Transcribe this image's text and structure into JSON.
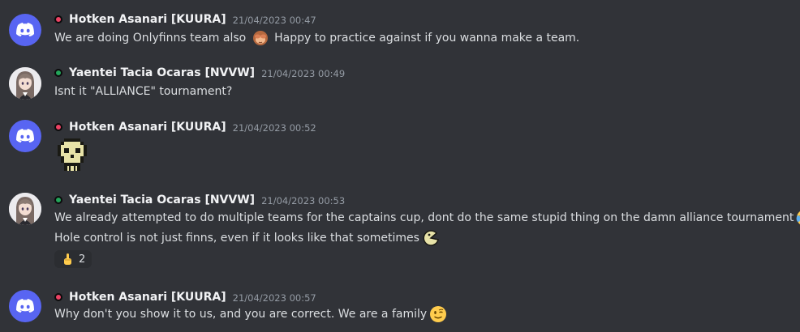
{
  "messages": [
    {
      "username": "Hotken Asanari [KUURA]",
      "timestamp": "21/04/2023 00:47",
      "role_color": "#ed4264",
      "avatar": "discord-logo-icon",
      "lines": [
        {
          "before": "We are doing Onlyfinns team also ",
          "emoji": "see-no-evil-monkey-icon",
          "after": " Happy to practice against if you wanna make a team."
        }
      ]
    },
    {
      "username": "Yaentei Tacia Ocaras [NVVW]",
      "timestamp": "21/04/2023 00:49",
      "role_color": "#23a55a",
      "avatar": "anime-girl-avatar",
      "lines": [
        {
          "before": "Isnt it \"ALLIANCE\" tournament?"
        }
      ]
    },
    {
      "username": "Hotken Asanari [KUURA]",
      "timestamp": "21/04/2023 00:52",
      "role_color": "#ed4264",
      "avatar": "discord-logo-icon",
      "sticker": "pixel-skull-sticker"
    },
    {
      "username": "Yaentei Tacia Ocaras [NVVW]",
      "timestamp": "21/04/2023 00:53",
      "role_color": "#23a55a",
      "avatar": "anime-girl-avatar",
      "lines": [
        {
          "before": "We already attempted to do multiple teams for the captains cup, dont do the same stupid thing on the damn alliance tournament",
          "emoji": "joy-icon"
        },
        {
          "before": "Hole control is not just finns, even if it looks like that sometimes",
          "emoji": "pacman-icon"
        }
      ],
      "reaction": {
        "emoji": "middle-finger-icon",
        "count": "2"
      }
    },
    {
      "username": "Hotken Asanari [KUURA]",
      "timestamp": "21/04/2023 00:57",
      "role_color": "#ed4264",
      "avatar": "discord-logo-icon",
      "lines": [
        {
          "before": "Why don't you show it to us, and you are correct. We are a family",
          "emoji": "wink-icon"
        }
      ]
    }
  ]
}
